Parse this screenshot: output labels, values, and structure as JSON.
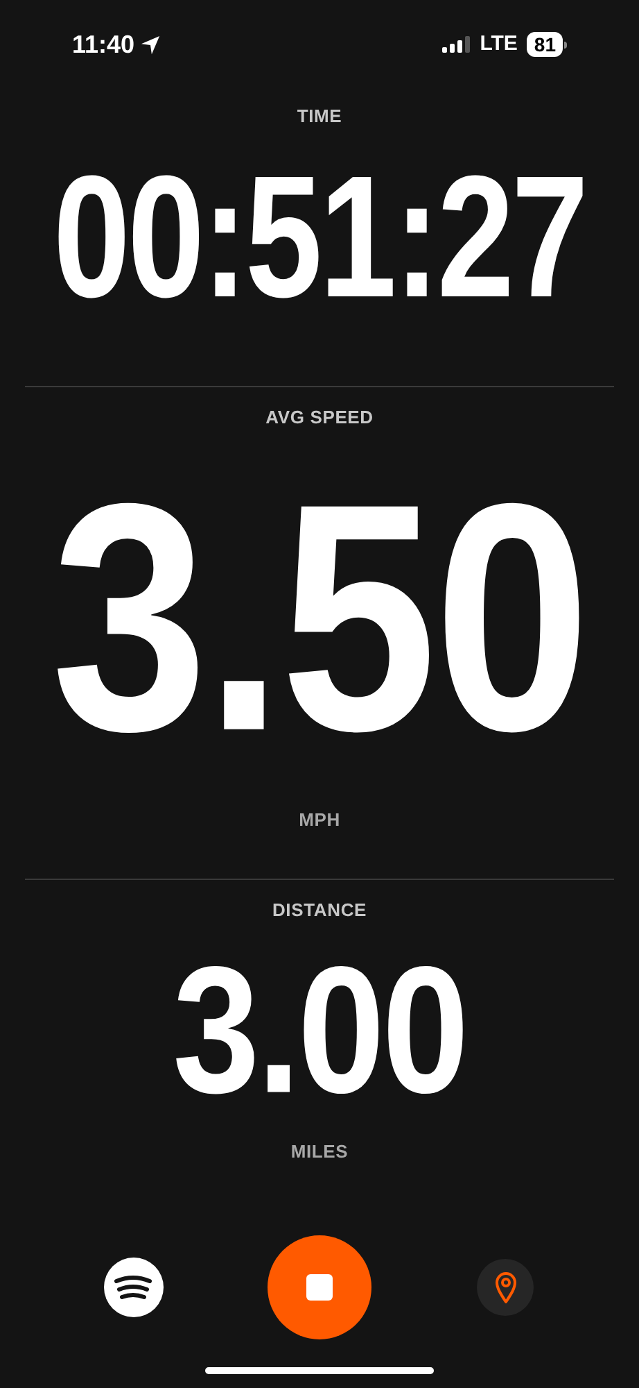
{
  "status_bar": {
    "time": "11:40",
    "network": "LTE",
    "battery": "81"
  },
  "metrics": [
    {
      "label": "TIME",
      "value": "00:51:27",
      "kind": "medium"
    },
    {
      "label": "AVG SPEED",
      "value": "3.50",
      "unit": "MPH",
      "kind": "large"
    },
    {
      "label": "DISTANCE",
      "value": "3.00",
      "unit": "MILES",
      "kind": "small"
    }
  ]
}
